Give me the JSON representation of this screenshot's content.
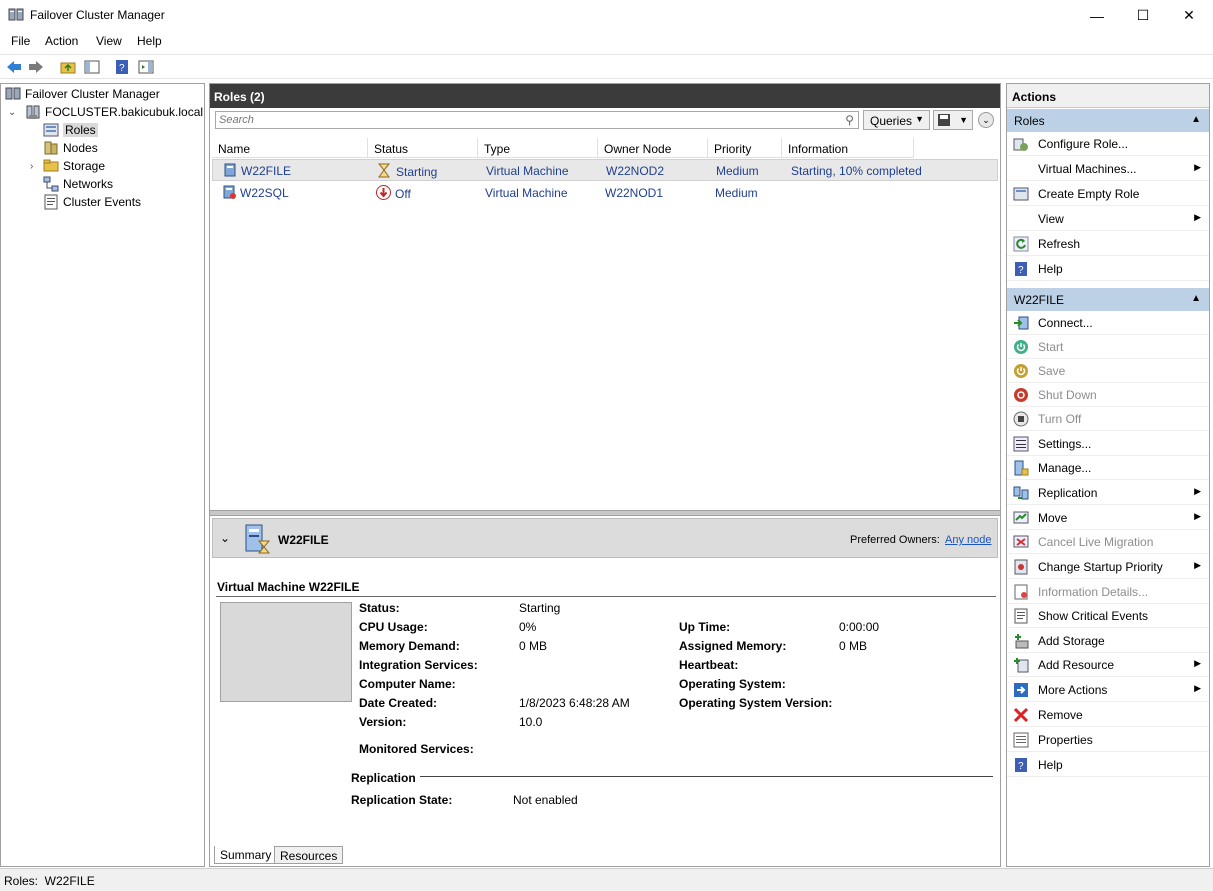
{
  "window": {
    "title": "Failover Cluster Manager",
    "minimize": "—",
    "maximize": "☐",
    "close": "✕"
  },
  "menu": [
    "File",
    "Action",
    "View",
    "Help"
  ],
  "tree": {
    "root": "Failover Cluster Manager",
    "cluster": "FOCLUSTER.bakicubuk.local",
    "items": [
      "Roles",
      "Nodes",
      "Storage",
      "Networks",
      "Cluster Events"
    ]
  },
  "roles_panel": {
    "header": "Roles (2)",
    "search_placeholder": "Search",
    "queries_label": "Queries",
    "columns": [
      "Name",
      "Status",
      "Type",
      "Owner Node",
      "Priority",
      "Information"
    ],
    "rows": [
      {
        "name": "W22FILE",
        "status": "Starting",
        "type": "Virtual Machine",
        "owner": "W22NOD2",
        "priority": "Medium",
        "information": "Starting, 10% completed"
      },
      {
        "name": "W22SQL",
        "status": "Off",
        "type": "Virtual Machine",
        "owner": "W22NOD1",
        "priority": "Medium",
        "information": ""
      }
    ]
  },
  "detail": {
    "name": "W22FILE",
    "preferred_owners_label": "Preferred Owners:",
    "preferred_owners_link": "Any node",
    "vm_title": "Virtual Machine W22FILE",
    "left_props": [
      {
        "label": "Status:",
        "value": "Starting"
      },
      {
        "label": "CPU Usage:",
        "value": "0%"
      },
      {
        "label": "Memory Demand:",
        "value": "0 MB"
      },
      {
        "label": "Integration Services:",
        "value": ""
      },
      {
        "label": "Computer Name:",
        "value": ""
      },
      {
        "label": "Date Created:",
        "value": "1/8/2023 6:48:28 AM"
      },
      {
        "label": "Version:",
        "value": "10.0"
      }
    ],
    "right_props": [
      {
        "label": "Up Time:",
        "value": "0:00:00"
      },
      {
        "label": "Assigned Memory:",
        "value": "0 MB"
      },
      {
        "label": "Heartbeat:",
        "value": ""
      },
      {
        "label": "Operating System:",
        "value": ""
      },
      {
        "label": "Operating System Version:",
        "value": ""
      }
    ],
    "monitored_services_label": "Monitored Services:",
    "replication_heading": "Replication",
    "replication_state_label": "Replication State:",
    "replication_state_value": "Not enabled",
    "tabs": [
      "Summary",
      "Resources"
    ]
  },
  "actions": {
    "title": "Actions",
    "roles_section": "Roles",
    "roles_items": [
      {
        "label": "Configure Role...",
        "icon": "configure-role-icon",
        "submenu": false,
        "disabled": false
      },
      {
        "label": "Virtual Machines...",
        "icon": "",
        "submenu": true,
        "disabled": false
      },
      {
        "label": "Create Empty Role",
        "icon": "empty-role-icon",
        "submenu": false,
        "disabled": false
      },
      {
        "label": "View",
        "icon": "",
        "submenu": true,
        "disabled": false
      },
      {
        "label": "Refresh",
        "icon": "refresh-icon",
        "submenu": false,
        "disabled": false
      },
      {
        "label": "Help",
        "icon": "help-icon",
        "submenu": false,
        "disabled": false
      }
    ],
    "vm_section": "W22FILE",
    "vm_items": [
      {
        "label": "Connect...",
        "icon": "connect-icon",
        "submenu": false,
        "disabled": false
      },
      {
        "label": "Start",
        "icon": "start-icon",
        "submenu": false,
        "disabled": true
      },
      {
        "label": "Save",
        "icon": "save-icon",
        "submenu": false,
        "disabled": true
      },
      {
        "label": "Shut Down",
        "icon": "shutdown-icon",
        "submenu": false,
        "disabled": true
      },
      {
        "label": "Turn Off",
        "icon": "turnoff-icon",
        "submenu": false,
        "disabled": true
      },
      {
        "label": "Settings...",
        "icon": "settings-icon",
        "submenu": false,
        "disabled": false
      },
      {
        "label": "Manage...",
        "icon": "manage-icon",
        "submenu": false,
        "disabled": false
      },
      {
        "label": "Replication",
        "icon": "replication-icon",
        "submenu": true,
        "disabled": false
      },
      {
        "label": "Move",
        "icon": "move-icon",
        "submenu": true,
        "disabled": false
      },
      {
        "label": "Cancel Live Migration",
        "icon": "cancel-migration-icon",
        "submenu": false,
        "disabled": true
      },
      {
        "label": "Change Startup Priority",
        "icon": "priority-icon",
        "submenu": true,
        "disabled": false
      },
      {
        "label": "Information Details...",
        "icon": "info-details-icon",
        "submenu": false,
        "disabled": true
      },
      {
        "label": "Show Critical Events",
        "icon": "critical-events-icon",
        "submenu": false,
        "disabled": false
      },
      {
        "label": "Add Storage",
        "icon": "add-storage-icon",
        "submenu": false,
        "disabled": false
      },
      {
        "label": "Add Resource",
        "icon": "add-resource-icon",
        "submenu": true,
        "disabled": false
      },
      {
        "label": "More Actions",
        "icon": "more-actions-icon",
        "submenu": true,
        "disabled": false
      },
      {
        "label": "Remove",
        "icon": "remove-icon",
        "submenu": false,
        "disabled": false
      },
      {
        "label": "Properties",
        "icon": "properties-icon",
        "submenu": false,
        "disabled": false
      },
      {
        "label": "Help",
        "icon": "help-icon",
        "submenu": false,
        "disabled": false
      }
    ]
  },
  "statusbar": {
    "text": "Roles:  W22FILE"
  }
}
